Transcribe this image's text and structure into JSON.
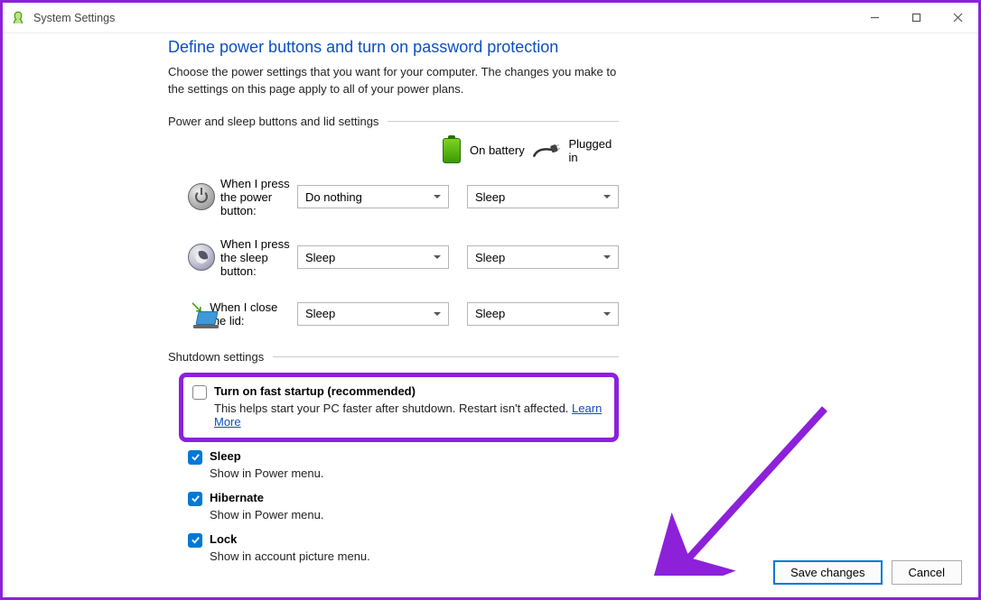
{
  "window": {
    "title": "System Settings"
  },
  "page": {
    "heading": "Define power buttons and turn on password protection",
    "subtext": "Choose the power settings that you want for your computer. The changes you make to the settings on this page apply to all of your power plans."
  },
  "power_section": {
    "label": "Power and sleep buttons and lid settings",
    "columns": {
      "battery": "On battery",
      "plugged": "Plugged in"
    },
    "rows": [
      {
        "label": "When I press the power button:",
        "battery": "Do nothing",
        "plugged": "Sleep"
      },
      {
        "label": "When I press the sleep button:",
        "battery": "Sleep",
        "plugged": "Sleep"
      },
      {
        "label": "When I close the lid:",
        "battery": "Sleep",
        "plugged": "Sleep"
      }
    ]
  },
  "shutdown_section": {
    "label": "Shutdown settings",
    "items": [
      {
        "title": "Turn on fast startup (recommended)",
        "desc": "This helps start your PC faster after shutdown. Restart isn't affected.",
        "learn": "Learn More",
        "checked": false
      },
      {
        "title": "Sleep",
        "desc": "Show in Power menu.",
        "checked": true
      },
      {
        "title": "Hibernate",
        "desc": "Show in Power menu.",
        "checked": true
      },
      {
        "title": "Lock",
        "desc": "Show in account picture menu.",
        "checked": true
      }
    ]
  },
  "footer": {
    "save": "Save changes",
    "cancel": "Cancel"
  },
  "colors": {
    "accent": "#8C21D9",
    "link": "#0B4FC4"
  }
}
